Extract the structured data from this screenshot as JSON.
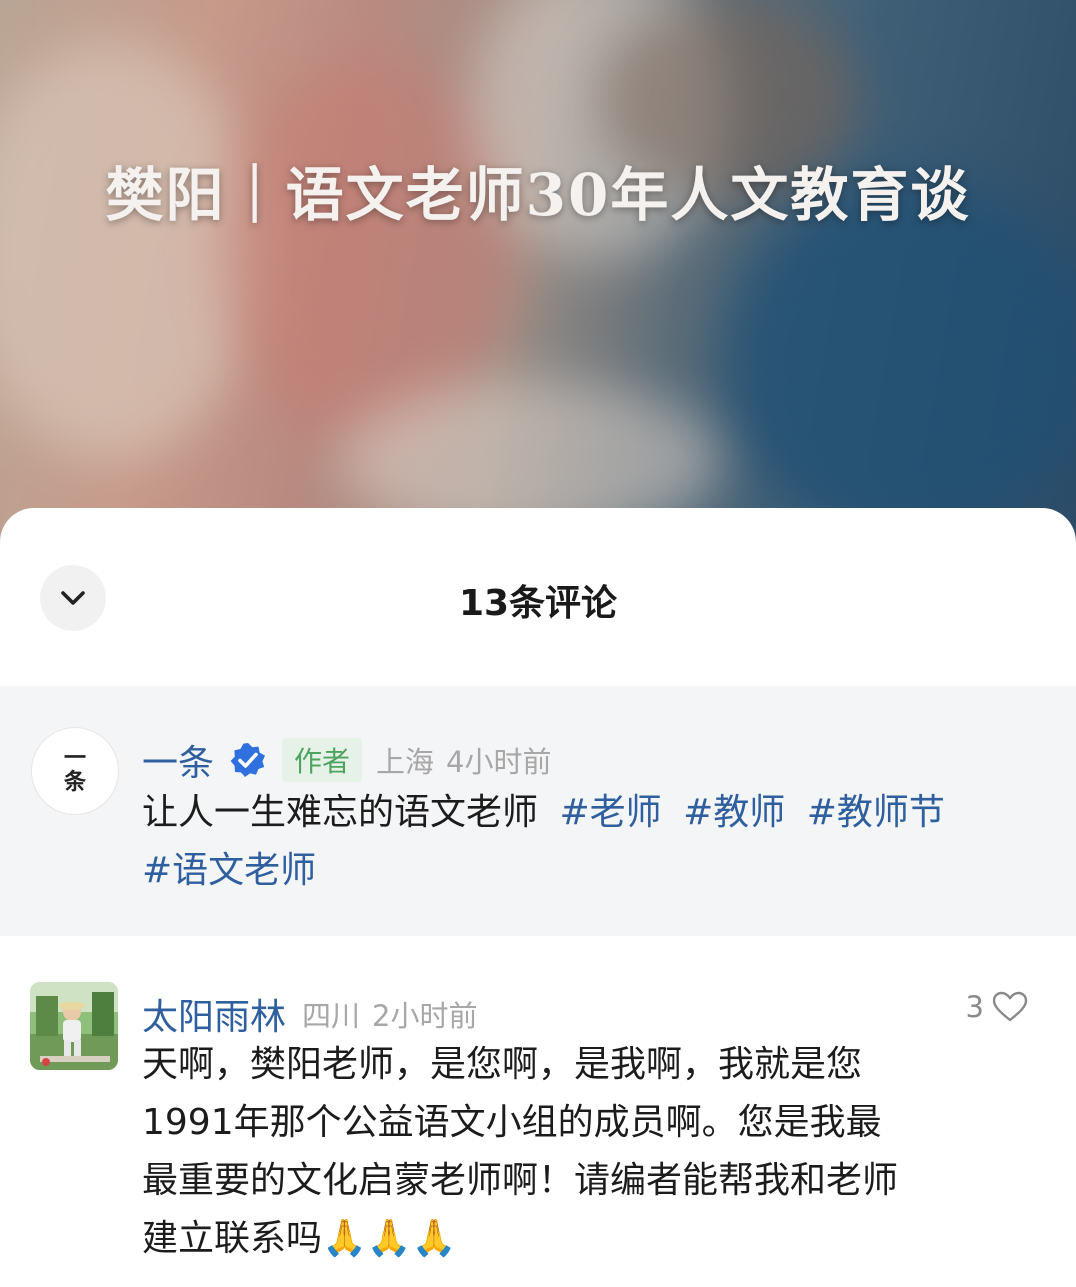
{
  "cover": {
    "title": "樊阳｜语文老师30年人文教育谈"
  },
  "sheet": {
    "title": "13条评论",
    "collapse_icon": "chevron-down-icon"
  },
  "pinned_comment": {
    "avatar_text_top": "一",
    "avatar_text_bottom": "条",
    "username": "一条",
    "badge_icon": "verified-badge-icon",
    "author_tag": "作者",
    "location": "上海",
    "time": "4小时前",
    "text": "让人一生难忘的语文老师",
    "hashtags": [
      "#老师",
      "#教师",
      "#教师节",
      "#语文老师"
    ]
  },
  "comments": [
    {
      "username": "太阳雨林",
      "location": "四川",
      "time": "2小时前",
      "likes": "3",
      "like_icon": "heart-outline-icon",
      "lines": [
        "天啊，樊阳老师，是您啊，是我啊，我就是您",
        "1991年那个公益语文小组的成员啊。您是我最",
        "最重要的文化启蒙老师啊！请编者能帮我和老师",
        "建立联系吗🙏🙏🙏"
      ]
    }
  ],
  "colors": {
    "link": "#2f5f9e",
    "author_tag_bg": "#e6f2e8",
    "author_tag_text": "#4ea45f",
    "verified": "#2f6fde",
    "pinned_bg": "#f4f5f7"
  }
}
